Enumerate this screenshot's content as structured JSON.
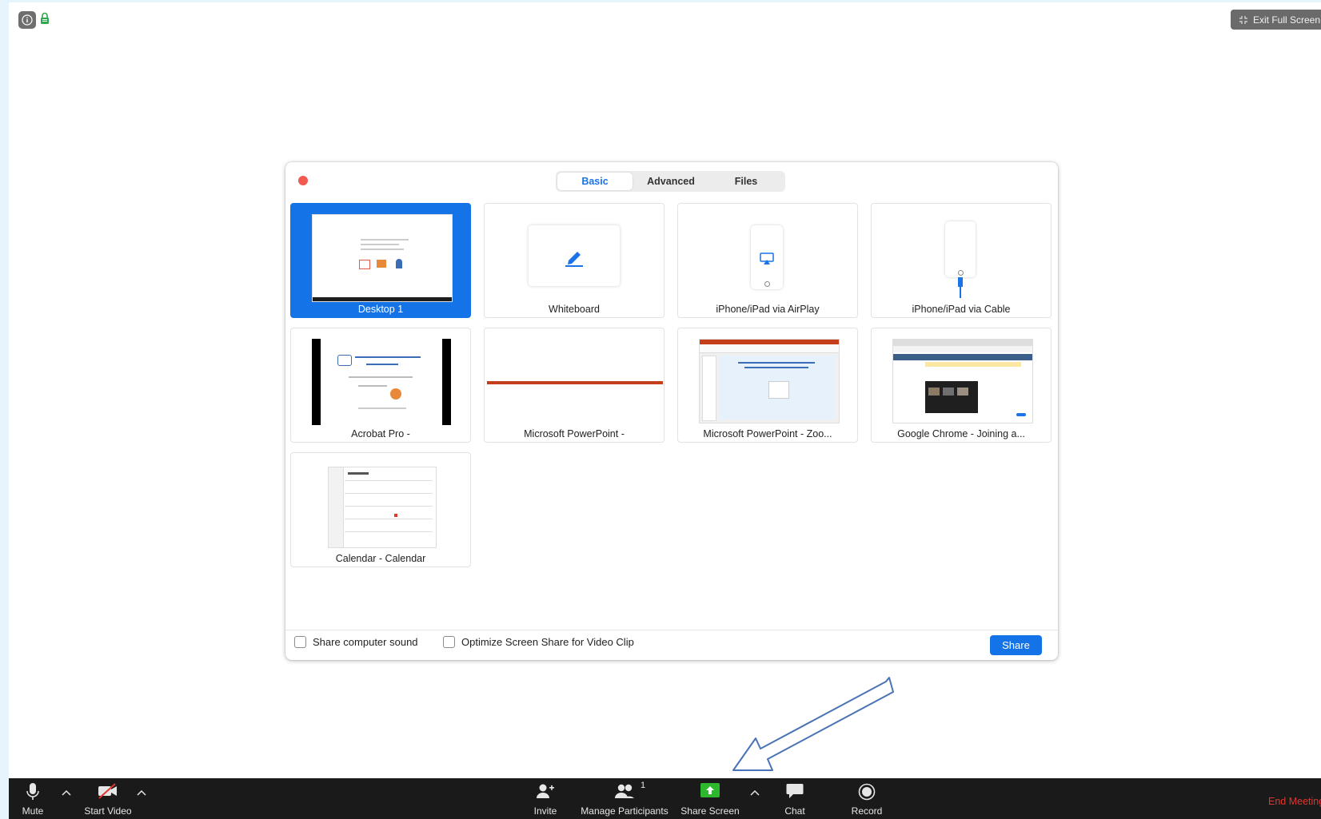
{
  "dialog": {
    "tabs": [
      {
        "label": "Basic"
      },
      {
        "label": "Advanced"
      },
      {
        "label": "Files"
      }
    ],
    "tiles": [
      {
        "label": "Desktop 1"
      },
      {
        "label": "Whiteboard"
      },
      {
        "label": "iPhone/iPad via AirPlay"
      },
      {
        "label": "iPhone/iPad via Cable"
      },
      {
        "label": "Acrobat Pro -"
      },
      {
        "label": "Microsoft PowerPoint -"
      },
      {
        "label": "Microsoft PowerPoint - Zoo..."
      },
      {
        "label": "Google Chrome - Joining a..."
      },
      {
        "label": "Calendar - Calendar"
      }
    ],
    "options": {
      "share_sound": "Share computer sound",
      "optimize_video": "Optimize Screen Share for Video Clip"
    },
    "share_button": "Share"
  },
  "topbar": {
    "exit_full_screen": "Exit Full Screen"
  },
  "toolbar": {
    "mute": "Mute",
    "start_video": "Start Video",
    "invite": "Invite",
    "manage_participants": "Manage Participants",
    "participant_count": "1",
    "share_screen": "Share Screen",
    "chat": "Chat",
    "record": "Record",
    "end_meeting": "End Meeting"
  },
  "colors": {
    "accent": "#1473e6",
    "share_green": "#2eb82e",
    "end_red": "#e0372f",
    "toolbar_bg": "#1a1a1a"
  }
}
